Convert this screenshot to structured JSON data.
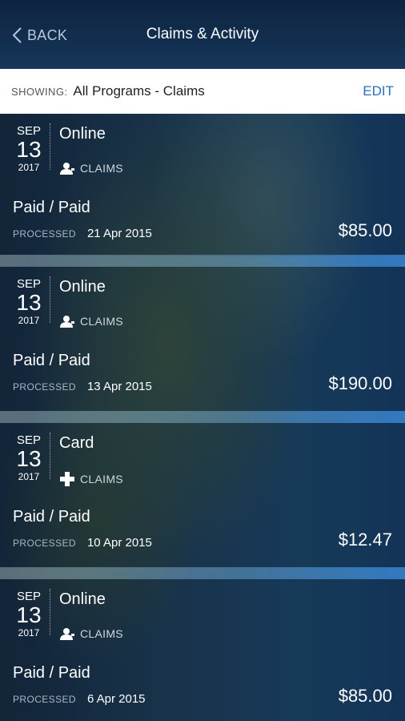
{
  "header": {
    "back_label": "BACK",
    "title": "Claims & Activity"
  },
  "filter": {
    "showing_label": "SHOWING:",
    "value": "All Programs - Claims",
    "edit_label": "EDIT"
  },
  "claims": [
    {
      "month": "SEP",
      "day": "13",
      "year": "2017",
      "channel": "Online",
      "type_icon": "person-icon",
      "type": "CLAIMS",
      "status": "Paid / Paid",
      "processed_label": "PROCESSED",
      "processed_date": "21 Apr 2015",
      "amount": "$85.00"
    },
    {
      "month": "SEP",
      "day": "13",
      "year": "2017",
      "channel": "Online",
      "type_icon": "person-icon",
      "type": "CLAIMS",
      "status": "Paid / Paid",
      "processed_label": "PROCESSED",
      "processed_date": "13 Apr 2015",
      "amount": "$190.00"
    },
    {
      "month": "SEP",
      "day": "13",
      "year": "2017",
      "channel": "Card",
      "type_icon": "cross-icon",
      "type": "CLAIMS",
      "status": "Paid / Paid",
      "processed_label": "PROCESSED",
      "processed_date": "10 Apr 2015",
      "amount": "$12.47"
    },
    {
      "month": "SEP",
      "day": "13",
      "year": "2017",
      "channel": "Online",
      "type_icon": "person-icon",
      "type": "CLAIMS",
      "status": "Paid / Paid",
      "processed_label": "PROCESSED",
      "processed_date": "6 Apr 2015",
      "amount": "$85.00"
    }
  ],
  "colors": {
    "header_bg": "#16365a",
    "edit": "#2a6fb8",
    "separator": "#3c8cdc"
  }
}
